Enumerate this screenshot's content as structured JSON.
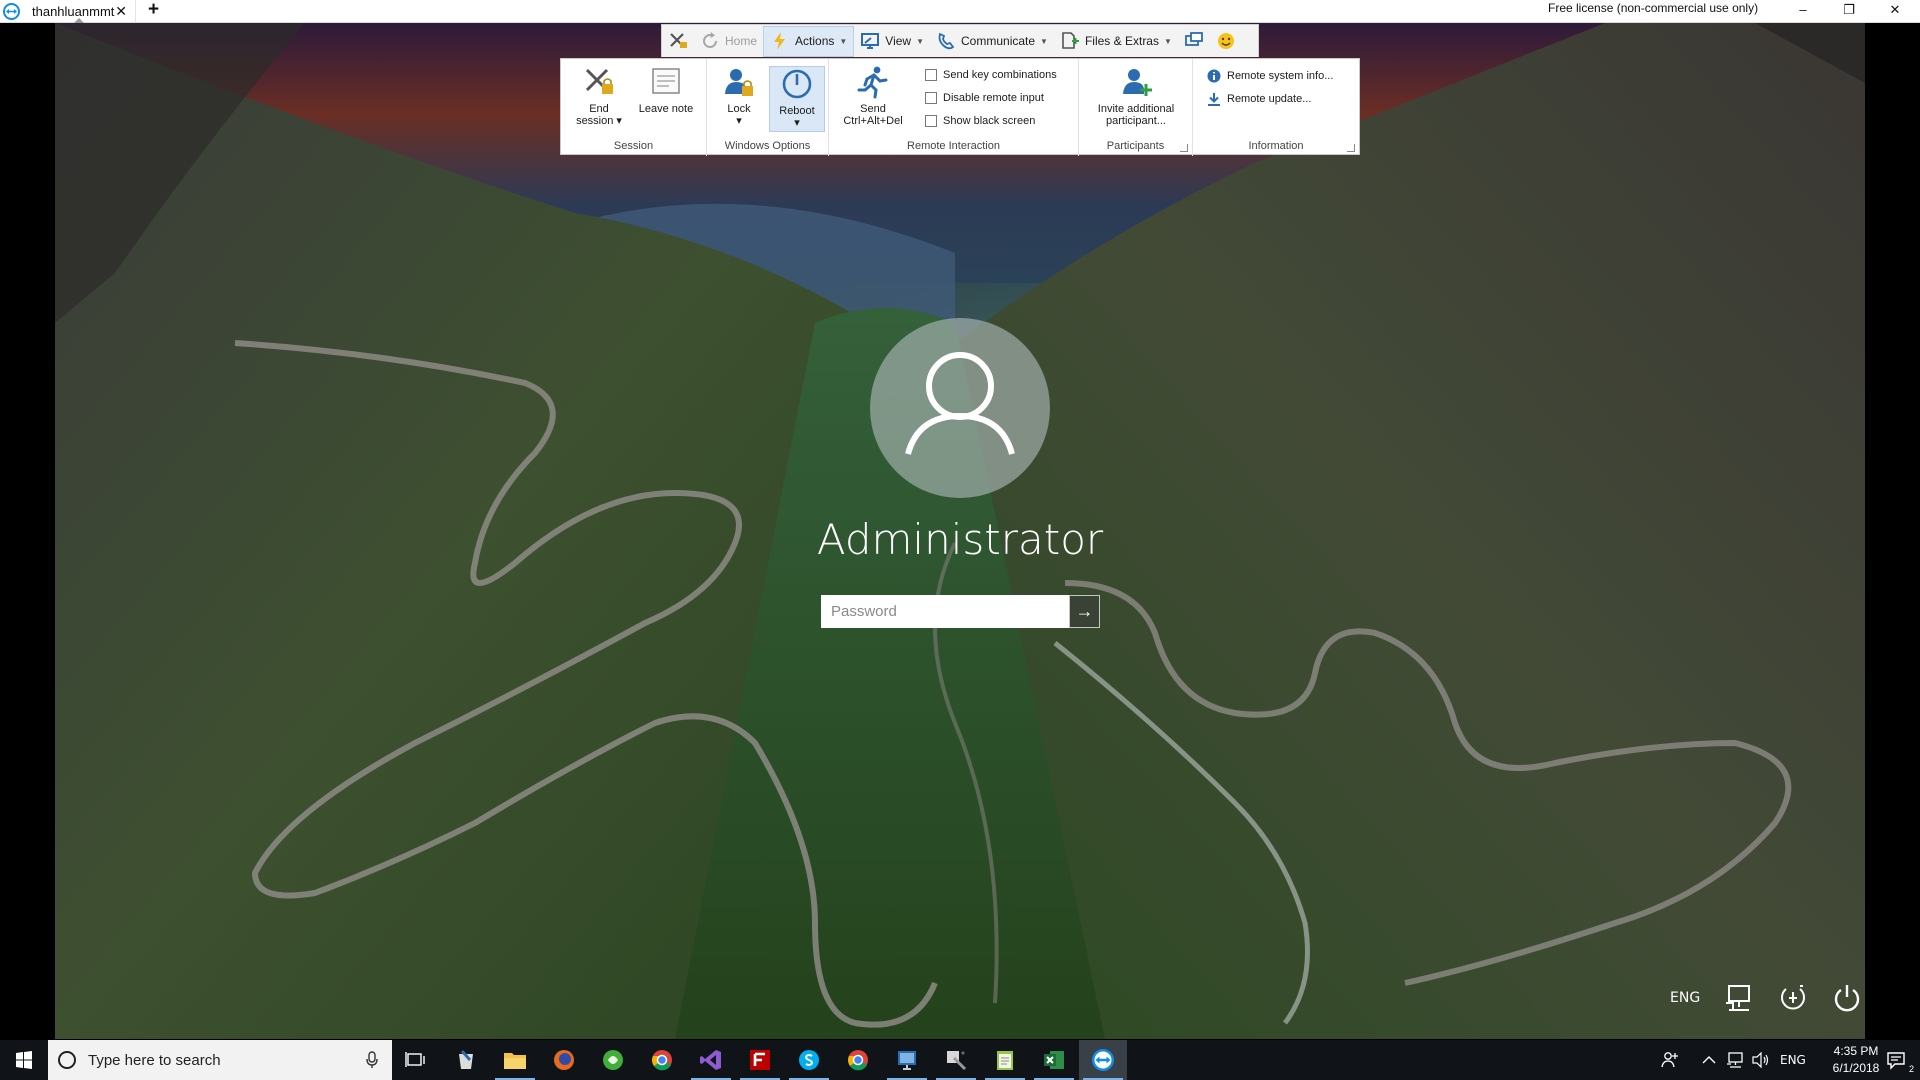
{
  "teamviewer": {
    "tab": {
      "title": "thanhluanmmt",
      "close": "✕"
    },
    "new_tab": "+",
    "license_text": "Free license (non-commercial use only)",
    "window_controls": {
      "minimize": "–",
      "restore": "❐",
      "close": "✕"
    },
    "toolbar": {
      "home": "Home",
      "actions": "Actions",
      "view": "View",
      "communicate": "Communicate",
      "files_extras": "Files & Extras"
    },
    "ribbon": {
      "session": {
        "caption": "Session",
        "end_session": [
          "End",
          "session ▾"
        ],
        "leave_note": "Leave note"
      },
      "windows_options": {
        "caption": "Windows Options",
        "lock": [
          "Lock",
          "▾"
        ],
        "reboot": [
          "Reboot",
          "▾"
        ]
      },
      "remote_interaction": {
        "caption": "Remote Interaction",
        "send_cad": [
          "Send",
          "Ctrl+Alt+Del"
        ],
        "send_key_combinations": "Send key combinations",
        "disable_remote_input": "Disable remote input",
        "show_black_screen": "Show black screen"
      },
      "participants": {
        "caption": "Participants",
        "invite": [
          "Invite additional",
          "participant..."
        ]
      },
      "information": {
        "caption": "Information",
        "remote_system_info": "Remote system info...",
        "remote_update": "Remote update..."
      }
    }
  },
  "lockscreen": {
    "username": "Administrator",
    "password_placeholder": "Password",
    "submit_arrow": "→",
    "language": "ENG"
  },
  "taskbar": {
    "search_placeholder": "Type here to search",
    "language": "ENG",
    "time": "4:35 PM",
    "date": "6/1/2018",
    "notification_count": "2"
  },
  "colors": {
    "teamviewer_blue": "#0e8ee9",
    "taskbar": "#101418",
    "active_tab_highlight": "#dde9f7"
  }
}
